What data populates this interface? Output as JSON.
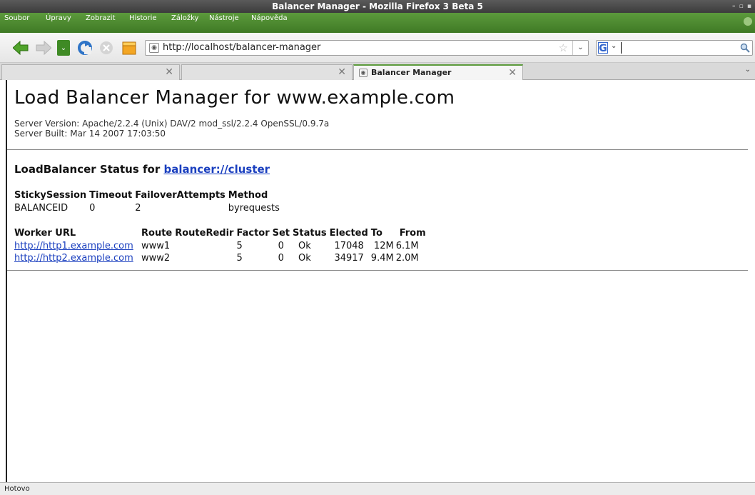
{
  "window": {
    "title": "Balancer Manager - Mozilla Firefox 3 Beta 5"
  },
  "menu": {
    "items": [
      "Soubor",
      "Úpravy",
      "Zobrazit",
      "Historie",
      "Záložky",
      "Nástroje",
      "Nápověda"
    ]
  },
  "toolbar": {
    "url": "http://localhost/balancer-manager",
    "search_value": ""
  },
  "tabs": [
    {
      "label": ""
    },
    {
      "label": ""
    },
    {
      "label": "Balancer Manager"
    }
  ],
  "page": {
    "heading": "Load Balancer Manager for www.example.com",
    "server_version": "Server Version: Apache/2.2.4 (Unix) DAV/2 mod_ssl/2.2.4 OpenSSL/0.9.7a",
    "server_built": "Server Built: Mar 14 2007 17:03:50",
    "status_prefix": "LoadBalancer Status for ",
    "balancer_link": "balancer://cluster",
    "sticky_table": {
      "headers": [
        "StickySession",
        "Timeout",
        "FailoverAttempts",
        "Method"
      ],
      "row": [
        "BALANCEID",
        "0",
        "2",
        "byrequests"
      ]
    },
    "worker_table": {
      "headers": [
        "Worker URL",
        "Route",
        "RouteRedir",
        "Factor",
        "Set",
        "Status",
        "Elected",
        "To",
        "From"
      ],
      "rows": [
        [
          "http://http1.example.com",
          "www1",
          "",
          "5",
          "0",
          "Ok",
          "17048",
          "12M",
          "6.1M"
        ],
        [
          "http://http2.example.com",
          "www2",
          "",
          "5",
          "0",
          "Ok",
          "34917",
          "9.4M",
          "2.0M"
        ]
      ]
    }
  },
  "status_bar": {
    "text": "Hotovo"
  },
  "colors": {
    "menubar": "#4a8a2e",
    "link": "#1a3fbf",
    "titlebar": "#4a4a4a"
  }
}
